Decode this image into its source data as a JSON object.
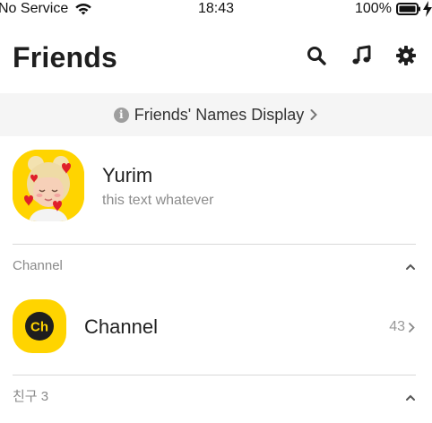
{
  "status_bar": {
    "carrier": "No Service",
    "time": "18:43",
    "battery": "100%"
  },
  "header": {
    "title": "Friends",
    "icons": [
      "search-icon",
      "music-note-icon",
      "gear-icon"
    ]
  },
  "banner": {
    "text": "Friends' Names Display"
  },
  "profile": {
    "name": "Yurim",
    "status": "this text whatever"
  },
  "sections": {
    "channel": {
      "label": "Channel"
    },
    "friends": {
      "label": "친구 3"
    }
  },
  "channel_item": {
    "name": "Channel",
    "count": "43",
    "icon_text": "Ch"
  },
  "colors": {
    "accent_yellow": "#ffd400",
    "banner_bg": "#f5f5f5",
    "divider": "#d9d9d9"
  }
}
